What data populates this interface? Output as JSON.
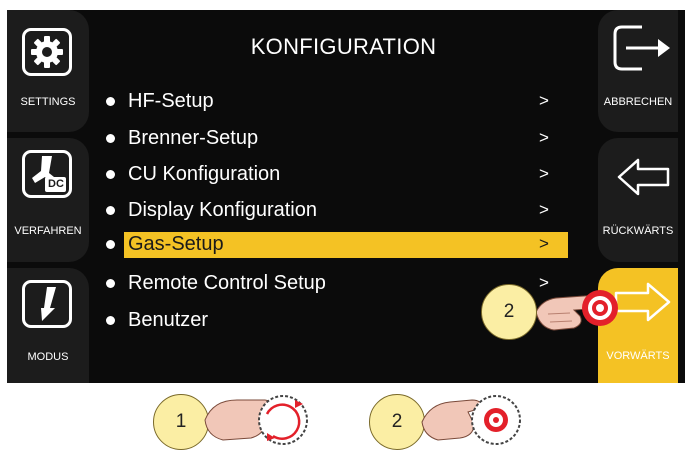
{
  "title": "KONFIGURATION",
  "left_buttons": [
    {
      "label": "SETTINGS",
      "icon": "gear-icon"
    },
    {
      "label": "VERFAHREN",
      "icon": "torch-dc-icon",
      "icon_text": "DC"
    },
    {
      "label": "MODUS",
      "icon": "trigger-icon"
    }
  ],
  "right_buttons": [
    {
      "label": "ABBRECHEN",
      "icon": "exit-arrow-icon"
    },
    {
      "label": "RÜCKWÄRTS",
      "icon": "back-arrow-icon"
    },
    {
      "label": "VORWÄRTS",
      "icon": "forward-arrow-icon",
      "active": true
    }
  ],
  "menu": [
    {
      "label": "HF-Setup",
      "arrow": ">"
    },
    {
      "label": "Brenner-Setup",
      "arrow": ">"
    },
    {
      "label": "CU Konfiguration",
      "arrow": ">"
    },
    {
      "label": "Display Konfiguration",
      "arrow": ">"
    },
    {
      "label": "Gas-Setup",
      "arrow": ">",
      "selected": true
    },
    {
      "label": "Remote Control Setup",
      "arrow": ">"
    },
    {
      "label": "Benutzer",
      "arrow": ""
    }
  ],
  "callouts": {
    "one": "1",
    "two": "2",
    "three": "2"
  },
  "colors": {
    "accent": "#f4c224",
    "screen_bg": "#0b0b0b",
    "button_bg": "#1c1c1c",
    "callout": "#fbeea4",
    "press": "#e3202a"
  }
}
